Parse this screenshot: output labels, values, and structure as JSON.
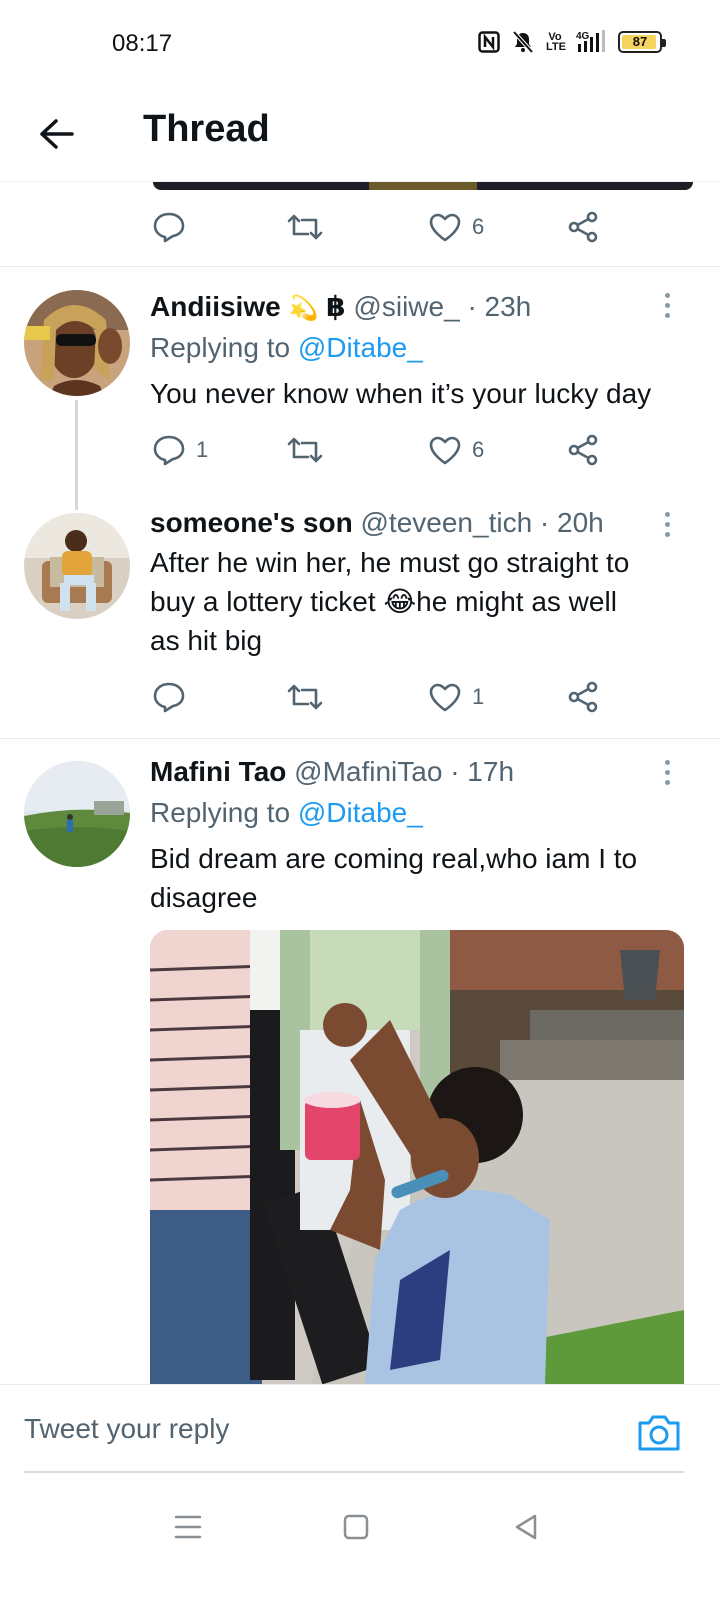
{
  "status_bar": {
    "time": "08:17",
    "battery": "87",
    "network": "4G",
    "volte": "Vo LTE"
  },
  "header": {
    "title": "Thread",
    "back_icon": "arrow-left-icon"
  },
  "top_tweet_actions": {
    "reply_count": "",
    "retweet_count": "",
    "like_count": "6"
  },
  "tweets": [
    {
      "name": "Andiisiwe",
      "emoji": "💫",
      "badge": "฿",
      "handle": "@siiwe_",
      "time": "· 23h",
      "replying_prefix": "Replying to",
      "replying_handle": "@Ditabe_",
      "text": "You never know when it’s your lucky day",
      "reply_count": "1",
      "retweet_count": "",
      "like_count": "6"
    },
    {
      "name": "someone's son",
      "handle": "@teveen_tich",
      "time": "· 20h",
      "text_line1": "After he win her, he must go straight to",
      "text_line2_a": "buy a lottery ticket ",
      "text_emoji": "😂",
      "text_line2_b": "he might as well",
      "text_line3": "as hit big",
      "reply_count": "",
      "retweet_count": "",
      "like_count": "1"
    },
    {
      "name": "Mafini Tao",
      "handle": "@MafiniTao",
      "time": "· 17h",
      "replying_prefix": "Replying to",
      "replying_handle": "@Ditabe_",
      "text_line1": "Bid dream are coming real,who iam I to",
      "text_line2": "disagree"
    }
  ],
  "reply_bar": {
    "placeholder": "Tweet your reply",
    "camera_icon": "camera-icon"
  },
  "nav_bar": {
    "items": [
      "menu-icon",
      "home-square-icon",
      "back-triangle-icon"
    ]
  },
  "colors": {
    "accent": "#1d9bf0",
    "secondary_text": "#536471",
    "primary_text": "#0f1419"
  }
}
